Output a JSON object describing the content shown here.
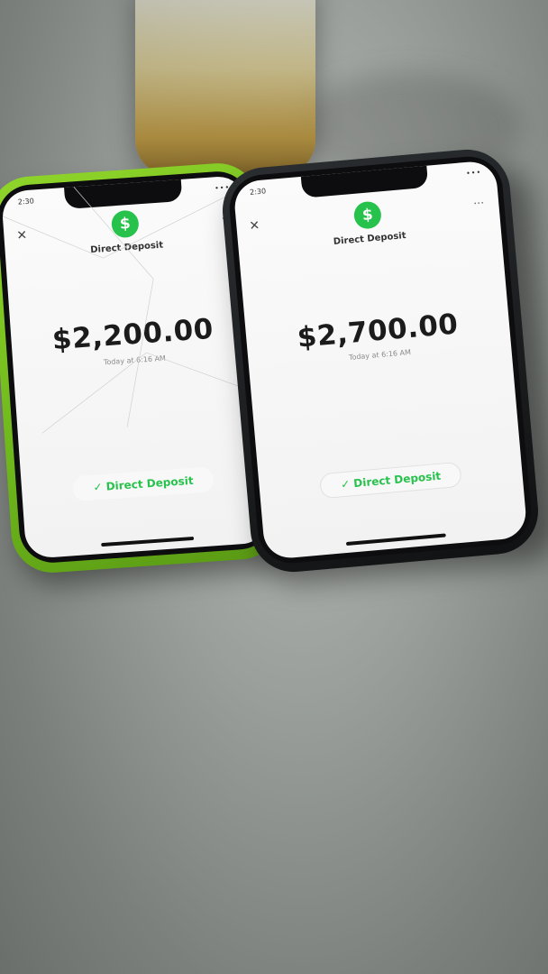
{
  "phone_left": {
    "status_time": "2:30",
    "status_icons": "•••",
    "close_icon": "close-icon",
    "more_icon": "more-icon",
    "dollar_symbol": "$",
    "title": "Direct Deposit",
    "amount": "$2,200.00",
    "timestamp": "Today at 6:16 AM",
    "status_check": "✓",
    "status_label": "Direct Deposit",
    "case_color": "#7cc522",
    "accent": "#27c24c"
  },
  "phone_right": {
    "status_time": "2:30",
    "status_icons": "•••",
    "close_icon": "close-icon",
    "more_icon": "more-icon",
    "dollar_symbol": "$",
    "title": "Direct Deposit",
    "amount": "$2,700.00",
    "timestamp": "Today at 6:16 AM",
    "status_check": "✓",
    "status_label": "Direct Deposit",
    "case_color": "#1c1e20",
    "accent": "#27c24c"
  }
}
